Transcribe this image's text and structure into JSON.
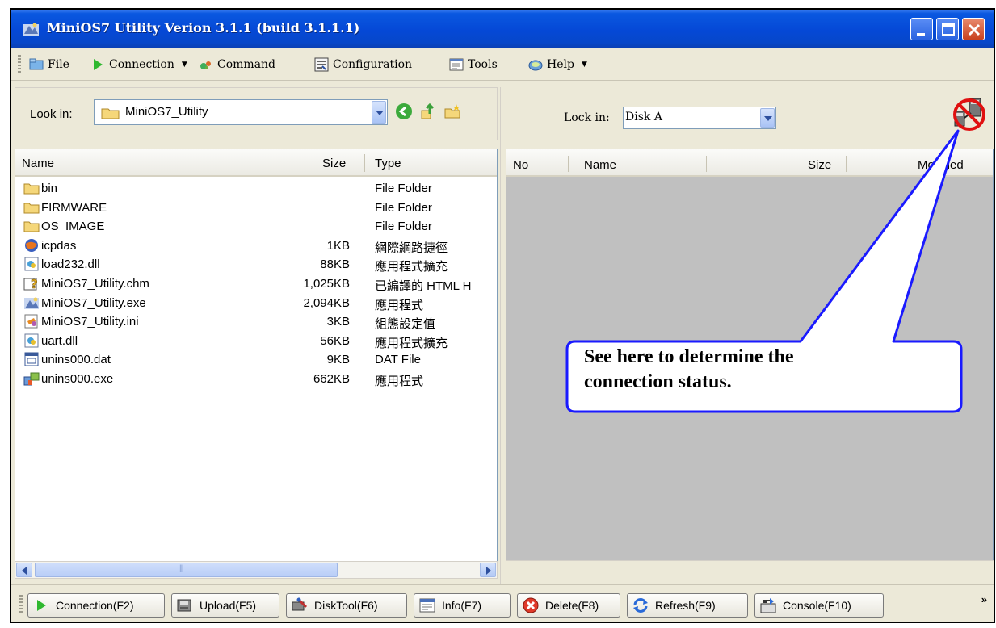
{
  "window": {
    "title": "MiniOS7 Utility Verion 3.1.1 (build 3.1.1.1)"
  },
  "menu": {
    "items": [
      {
        "label": "File",
        "icon": "folder-icon"
      },
      {
        "label": "Connection",
        "icon": "play-arrow-icon"
      },
      {
        "label": "Command",
        "icon": "command-icon"
      },
      {
        "label": "Configuration",
        "icon": "configuration-icon"
      },
      {
        "label": "Tools",
        "icon": "tools-icon"
      },
      {
        "label": "Help",
        "icon": "help-icon"
      }
    ]
  },
  "left_pane": {
    "look_in_label": "Look in:",
    "look_in_value": "MiniOS7_Utility",
    "columns": [
      "Name",
      "Size",
      "Type"
    ],
    "files": [
      {
        "name": "bin",
        "size": "",
        "type": "File Folder",
        "icon": "folder-icon"
      },
      {
        "name": "FIRMWARE",
        "size": "",
        "type": "File Folder",
        "icon": "folder-icon"
      },
      {
        "name": "OS_IMAGE",
        "size": "",
        "type": "File Folder",
        "icon": "folder-icon"
      },
      {
        "name": "icpdas",
        "size": "1KB",
        "type": "網際網路捷徑",
        "icon": "internet-shortcut-icon"
      },
      {
        "name": "load232.dll",
        "size": "88KB",
        "type": "應用程式擴充",
        "icon": "dll-icon"
      },
      {
        "name": "MiniOS7_Utility.chm",
        "size": "1,025KB",
        "type": "已編譯的 HTML H",
        "icon": "help-file-icon"
      },
      {
        "name": "MiniOS7_Utility.exe",
        "size": "2,094KB",
        "type": "應用程式",
        "icon": "app-icon"
      },
      {
        "name": "MiniOS7_Utility.ini",
        "size": "3KB",
        "type": "組態設定值",
        "icon": "ini-file-icon"
      },
      {
        "name": "uart.dll",
        "size": "56KB",
        "type": "應用程式擴充",
        "icon": "dll-icon"
      },
      {
        "name": "unins000.dat",
        "size": "9KB",
        "type": "DAT File",
        "icon": "dat-file-icon"
      },
      {
        "name": "unins000.exe",
        "size": "662KB",
        "type": "應用程式",
        "icon": "installer-icon"
      }
    ]
  },
  "right_pane": {
    "look_in_label": "Lock in:",
    "look_in_value": "Disk A",
    "columns": [
      "No",
      "Name",
      "Size",
      "Modified"
    ],
    "status_icon": "disconnected-icon"
  },
  "bottom_toolbar": {
    "buttons": [
      {
        "label": "Connection(F2)",
        "icon": "play-arrow-icon"
      },
      {
        "label": "Upload(F5)",
        "icon": "upload-icon"
      },
      {
        "label": "DiskTool(F6)",
        "icon": "disktool-icon"
      },
      {
        "label": "Info(F7)",
        "icon": "info-icon"
      },
      {
        "label": "Delete(F8)",
        "icon": "delete-icon"
      },
      {
        "label": "Refresh(F9)",
        "icon": "refresh-icon"
      },
      {
        "label": "Console(F10)",
        "icon": "console-icon"
      }
    ],
    "overflow": "»"
  },
  "callout": {
    "line1": "See here to determine the",
    "line2": "connection status."
  },
  "colors": {
    "titlebar": "#0548d6",
    "callout_border": "#1a1aff"
  }
}
